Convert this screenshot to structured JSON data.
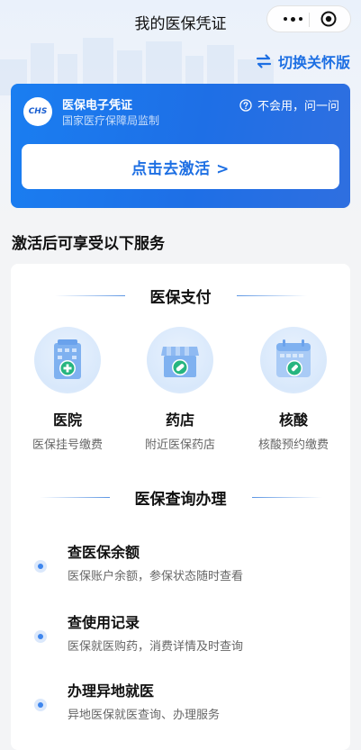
{
  "navbar": {
    "title": "我的医保凭证"
  },
  "switch_care": {
    "label": "切换关怀版"
  },
  "card": {
    "logo_text": "CHS",
    "title": "医保电子凭证",
    "subtitle": "国家医疗保障局监制",
    "help": "不会用，问一问",
    "activate": "点击去激活 >"
  },
  "services_heading": "激活后可享受以下服务",
  "payment": {
    "title": "医保支付",
    "items": [
      {
        "name": "医院",
        "desc": "医保挂号缴费",
        "icon": "hospital-icon"
      },
      {
        "name": "药店",
        "desc": "附近医保药店",
        "icon": "pharmacy-icon"
      },
      {
        "name": "核酸",
        "desc": "核酸预约缴费",
        "icon": "calendar-test-icon"
      }
    ]
  },
  "query": {
    "title": "医保查询办理",
    "items": [
      {
        "title": "查医保余额",
        "desc": "医保账户余额，参保状态随时查看"
      },
      {
        "title": "查使用记录",
        "desc": "医保就医购药，消费详情及时查询"
      },
      {
        "title": "办理异地就医",
        "desc": "异地医保就医查询、办理服务"
      }
    ]
  },
  "colors": {
    "primary": "#1d6fe3",
    "card_bg": "#1e74eb"
  }
}
